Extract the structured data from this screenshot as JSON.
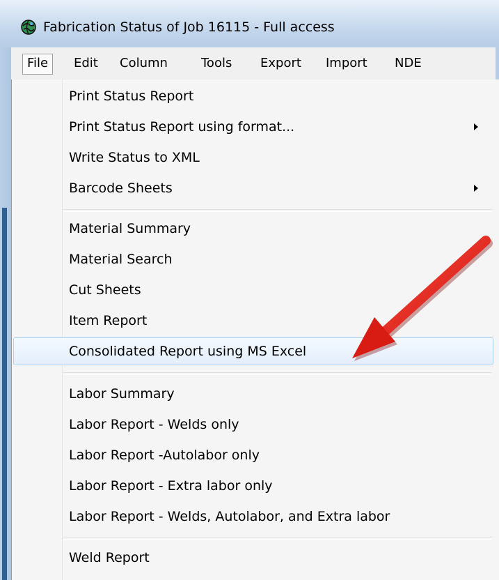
{
  "window": {
    "title": "Fabrication  Status of Job 16115  -  Full access",
    "icon": "app-globe-icon"
  },
  "menubar": {
    "items": [
      {
        "label": "File",
        "active": true
      },
      {
        "label": "Edit"
      },
      {
        "label": "Column"
      },
      {
        "label": "Tools"
      },
      {
        "label": "Export"
      },
      {
        "label": "Import"
      },
      {
        "label": "NDE"
      }
    ]
  },
  "file_menu": {
    "items": [
      {
        "label": "Print Status Report"
      },
      {
        "label": "Print Status Report using format...",
        "submenu": true
      },
      {
        "label": "Write Status to XML"
      },
      {
        "label": "Barcode Sheets",
        "submenu": true
      },
      {
        "label": "Material Summary"
      },
      {
        "label": "Material Search"
      },
      {
        "label": "Cut Sheets"
      },
      {
        "label": "Item Report"
      },
      {
        "label": "Consolidated Report using MS Excel",
        "highlighted": true
      },
      {
        "label": "Labor Summary"
      },
      {
        "label": "Labor Report - Welds only"
      },
      {
        "label": "Labor Report -Autolabor only"
      },
      {
        "label": "Labor Report - Extra labor only"
      },
      {
        "label": "Labor Report - Welds, Autolabor, and Extra labor"
      },
      {
        "label": "Weld Report"
      }
    ]
  },
  "annotation": {
    "type": "red-arrow",
    "color": "#e8221b",
    "points_to": "Consolidated Report using MS Excel"
  }
}
